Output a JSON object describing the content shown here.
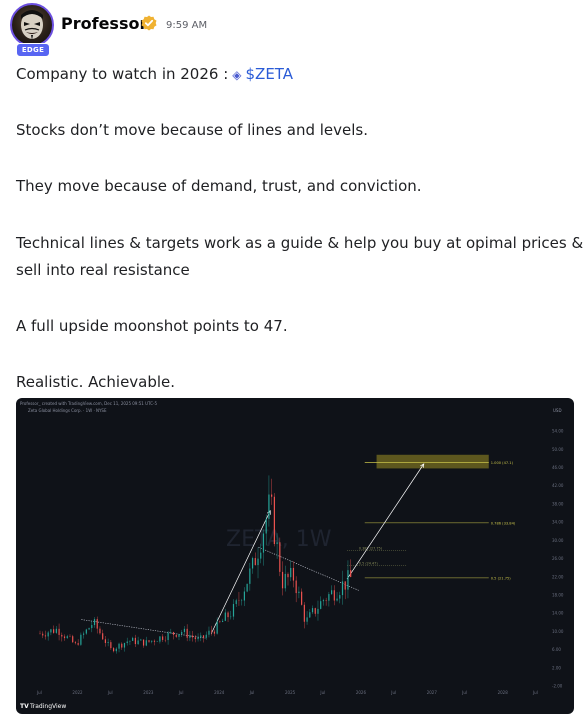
{
  "author": {
    "name": "Professor",
    "badge": "EDGE"
  },
  "message": {
    "time": "9:59 AM",
    "intro": "Company to watch in 2026 :",
    "ticker": "$ZETA",
    "lines": [
      "Stocks don’t move because of lines and levels.",
      "They move because of demand, trust, and conviction.",
      "Technical lines & targets work as a guide & help you buy at opimal prices &",
      "sell into real resistance",
      "A full upside moonshot points to 47.",
      "Realistic. Achievable."
    ]
  },
  "chart": {
    "header": "Professor_ created with TradingView.com, Dec 11, 2025 09:51 UTC-5",
    "symbol_line": "Zeta Global Holdings Corp. · 1W · NYSE",
    "watermark": "ZETA, 1W",
    "footer_brand": "TradingView",
    "currency": "USD",
    "price_scale": [
      "54.00",
      "50.00",
      "46.00",
      "42.00",
      "38.00",
      "34.00",
      "30.00",
      "26.00",
      "22.00",
      "18.00",
      "14.00",
      "10.00",
      "6.00",
      "2.00",
      "-2.00"
    ],
    "time_scale": [
      "Jul",
      "2022",
      "Jul",
      "2023",
      "Jul",
      "2024",
      "Jul",
      "2025",
      "Jul",
      "2026",
      "Jul",
      "2027",
      "Jul",
      "2028",
      "Jul"
    ],
    "fib_labels": [
      "1.000 (47.1)",
      "0.786 (33.84)",
      "0.5 (21.75)"
    ],
    "mid_labels": [
      "0.382 (27.75)",
      "0.5 (24.47)"
    ],
    "colors": {
      "candle_up": "#26a69a",
      "candle_down": "#ef5350",
      "target_box": "#6b6420",
      "fib_line": "#c8c24a"
    }
  },
  "chart_data": {
    "type": "candlestick",
    "title": "Zeta Global Holdings Corp. · 1W · NYSE",
    "ylim": [
      -2,
      56
    ],
    "x_range": [
      "2021-07",
      "2028-07"
    ],
    "target_price": 47,
    "levels": [
      {
        "name": "1.000",
        "value": 47.1
      },
      {
        "name": "0.786",
        "value": 33.84
      },
      {
        "name": "0.5",
        "value": 21.75
      }
    ],
    "approx_closes": [
      {
        "x": "2021-07",
        "y": 9.5
      },
      {
        "x": "2021-10",
        "y": 10.5
      },
      {
        "x": "2022-01",
        "y": 7
      },
      {
        "x": "2022-04",
        "y": 12
      },
      {
        "x": "2022-07",
        "y": 6
      },
      {
        "x": "2022-10",
        "y": 8
      },
      {
        "x": "2023-01",
        "y": 7.5
      },
      {
        "x": "2023-04",
        "y": 9
      },
      {
        "x": "2023-07",
        "y": 10
      },
      {
        "x": "2023-10",
        "y": 8
      },
      {
        "x": "2024-01",
        "y": 11
      },
      {
        "x": "2024-04",
        "y": 15
      },
      {
        "x": "2024-07",
        "y": 24
      },
      {
        "x": "2024-10",
        "y": 38
      },
      {
        "x": "2024-12",
        "y": 21
      },
      {
        "x": "2025-02",
        "y": 22
      },
      {
        "x": "2025-04",
        "y": 12
      },
      {
        "x": "2025-07",
        "y": 17
      },
      {
        "x": "2025-10",
        "y": 20
      },
      {
        "x": "2025-12",
        "y": 22
      }
    ]
  }
}
